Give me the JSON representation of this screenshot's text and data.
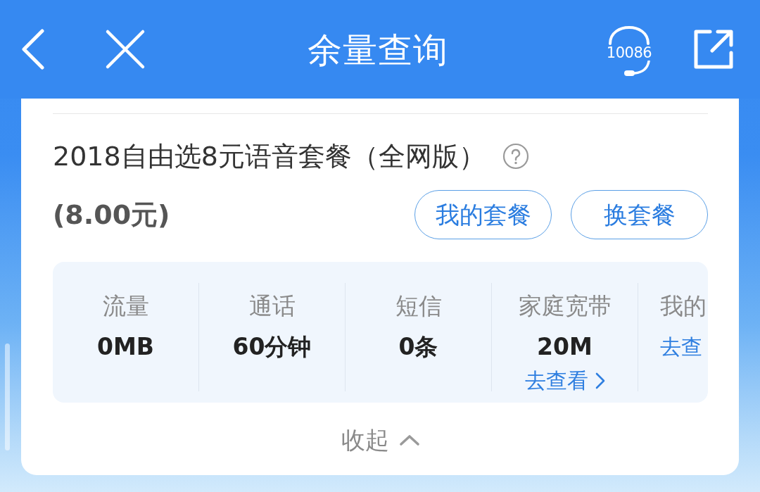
{
  "header": {
    "title": "余量查询",
    "hotline": "10086"
  },
  "plan": {
    "name": "2018自由选8元语音套餐（全网版）",
    "price": "(8.00元)",
    "buttons": [
      {
        "label": "我的套餐"
      },
      {
        "label": "换套餐"
      }
    ]
  },
  "usage": [
    {
      "kind": "full",
      "label": "流量",
      "value": "0MB"
    },
    {
      "kind": "full",
      "label": "通话",
      "value": "60分钟"
    },
    {
      "kind": "full",
      "label": "短信",
      "value": "0条"
    },
    {
      "kind": "full",
      "label": "家庭宽带",
      "value": "20M",
      "link": "去查看"
    },
    {
      "kind": "clipped",
      "label": "我的",
      "link": "去查"
    }
  ],
  "collapse": {
    "label": "收起"
  }
}
